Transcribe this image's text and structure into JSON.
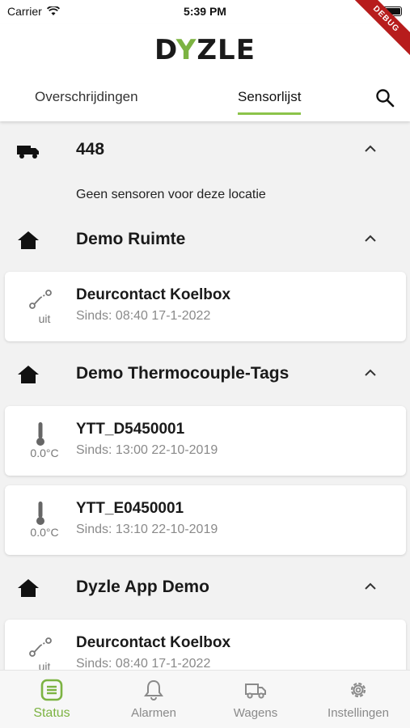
{
  "status_bar": {
    "carrier": "Carrier",
    "time": "5:39 PM",
    "debug_label": "DEBUG"
  },
  "header": {
    "logo": {
      "part1": "D",
      "part2": "Y",
      "part3": "ZLE"
    },
    "tabs": [
      {
        "label": "Overschrijdingen"
      },
      {
        "label": "Sensorlijst",
        "active": true
      }
    ]
  },
  "locations": [
    {
      "name": "448",
      "icon": "truck-icon",
      "empty_message": "Geen sensoren voor deze locatie"
    },
    {
      "name": "Demo Ruimte",
      "icon": "house-icon",
      "sensors": [
        {
          "title": "Deurcontact Koelbox",
          "status": "uit",
          "since": "Sinds: 08:40 17-1-2022",
          "icon": "door-contact-icon"
        }
      ]
    },
    {
      "name": "Demo Thermocouple-Tags",
      "icon": "house-icon",
      "sensors": [
        {
          "title": "YTT_D5450001",
          "status": "0.0°C",
          "since": "Sinds: 13:00 22-10-2019",
          "icon": "thermometer-icon"
        },
        {
          "title": "YTT_E0450001",
          "status": "0.0°C",
          "since": "Sinds: 13:10 22-10-2019",
          "icon": "thermometer-icon"
        }
      ]
    },
    {
      "name": "Dyzle App Demo",
      "icon": "house-icon",
      "sensors": [
        {
          "title": "Deurcontact Koelbox",
          "status": "uit",
          "since": "Sinds: 08:40 17-1-2022",
          "icon": "door-contact-icon"
        }
      ]
    }
  ],
  "bottom_nav": [
    {
      "label": "Status",
      "icon": "status-list-icon",
      "active": true
    },
    {
      "label": "Alarmen",
      "icon": "bell-icon"
    },
    {
      "label": "Wagens",
      "icon": "truck-icon"
    },
    {
      "label": "Instellingen",
      "icon": "gear-icon"
    }
  ],
  "colors": {
    "accent": "#7cb342",
    "debug_ribbon": "#b71c1c"
  }
}
